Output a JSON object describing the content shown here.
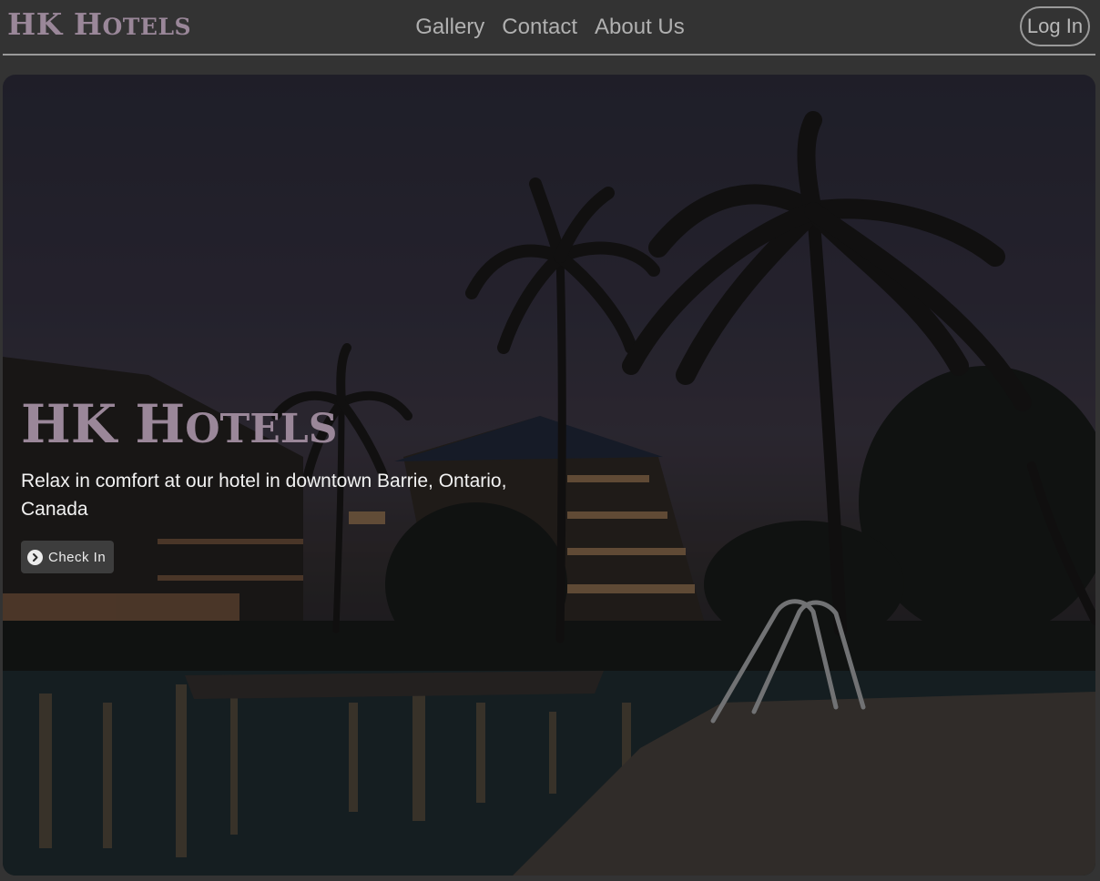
{
  "navbar": {
    "brand_big": "HK H",
    "brand_small": "OTELS",
    "links": [
      "Gallery",
      "Contact",
      "About Us"
    ],
    "login_label": "Log In"
  },
  "hero": {
    "title_big_1": "HK H",
    "title_small": "OTELS",
    "subtitle": "Relax in comfort at our hotel in downtown Barrie, Ontario, Canada",
    "checkin_label": "Check In",
    "checkin_icon": "chevron-circle-right-icon",
    "image_semantic": "night hotel pool with palm trees"
  },
  "colors": {
    "page_bg": "#333333",
    "brand": "#9a8799",
    "nav_text": "#b0b0b0",
    "button_bg": "#3d3d3d"
  }
}
